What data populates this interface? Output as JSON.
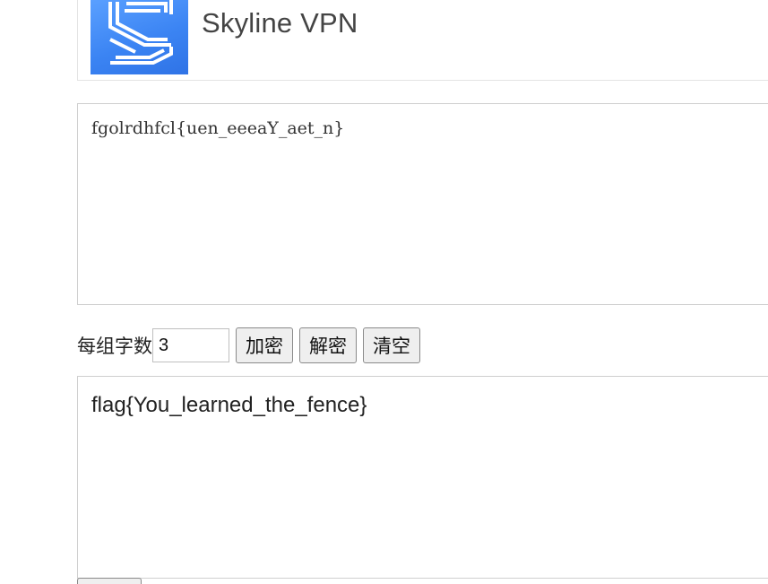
{
  "header": {
    "app_name": "Skyline VPN",
    "logo_icon": "skyline-s-logo-icon",
    "logo_color": "#3b84f3"
  },
  "input": {
    "value": "fgolrdhfcl{uen_eeeaY_aet_n}"
  },
  "controls": {
    "group_label": "每组字数",
    "group_value": "3",
    "encrypt_label": "加密",
    "decrypt_label": "解密",
    "clear_label": "清空"
  },
  "output": {
    "value": "flag{You_learned_the_fence}"
  }
}
